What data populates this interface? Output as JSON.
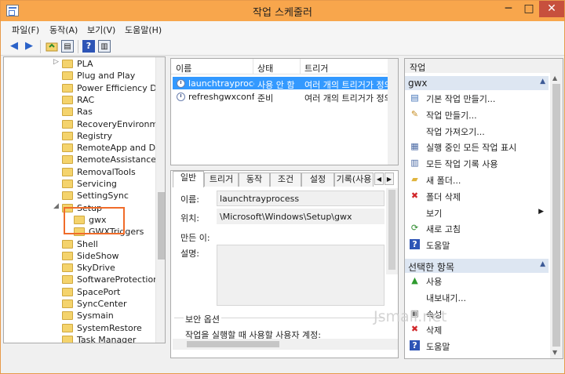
{
  "window": {
    "title": "작업 스케줄러",
    "minimize": "─",
    "maximize": "□",
    "close": "✕"
  },
  "menu": [
    "파일(F)",
    "동작(A)",
    "보기(V)",
    "도움말(H)"
  ],
  "toolbar": {
    "icons": [
      "back-arrow-icon",
      "forward-arrow-icon",
      "folder-up-icon",
      "show-hide-tree-icon",
      "help-icon",
      "show-hide-action-pane-icon"
    ]
  },
  "tree": {
    "items": [
      {
        "label": "PLA",
        "expander": "▷"
      },
      {
        "label": "Plug and Play"
      },
      {
        "label": "Power Efficiency Diag"
      },
      {
        "label": "RAC"
      },
      {
        "label": "Ras"
      },
      {
        "label": "RecoveryEnvironment"
      },
      {
        "label": "Registry"
      },
      {
        "label": "RemoteApp and Desk"
      },
      {
        "label": "RemoteAssistance"
      },
      {
        "label": "RemovalTools"
      },
      {
        "label": "Servicing"
      },
      {
        "label": "SettingSync"
      },
      {
        "label": "Setup",
        "expander": "◢"
      },
      {
        "label": "gwx",
        "child": true
      },
      {
        "label": "GWXTriggers",
        "child": true
      },
      {
        "label": "Shell"
      },
      {
        "label": "SideShow"
      },
      {
        "label": "SkyDrive"
      },
      {
        "label": "SoftwareProtectionPla"
      },
      {
        "label": "SpacePort"
      },
      {
        "label": "SyncCenter"
      },
      {
        "label": "Sysmain"
      },
      {
        "label": "SystemRestore"
      },
      {
        "label": "Task Manager"
      }
    ]
  },
  "task_list": {
    "columns": [
      "이름",
      "상태",
      "트리거"
    ],
    "rows": [
      {
        "name": "launchtrayprocess",
        "status": "사용 안 함",
        "trigger": "여러 개의 트리거가 정의되",
        "selected": true
      },
      {
        "name": "refreshgwxconfig",
        "status": "준비",
        "trigger": "여러 개의 트리거가 정의되",
        "selected": false
      }
    ]
  },
  "detail": {
    "tabs": [
      "일반",
      "트리거",
      "동작",
      "조건",
      "설정",
      "기록(사용"
    ],
    "name_label": "이름:",
    "name_value": "launchtrayprocess",
    "location_label": "위치:",
    "location_value": "\\Microsoft\\Windows\\Setup\\gwx",
    "author_label": "만든 이:",
    "description_label": "설명:",
    "security_options": "보안 옵션",
    "run_as_text": "작업을 실행할 때 사용할 사용자 계정:"
  },
  "actions": {
    "header": "작업",
    "section1": "gwx",
    "section1_items": [
      {
        "label": "기본 작업 만들기...",
        "icon": "create-basic-task-icon"
      },
      {
        "label": "작업 만들기...",
        "icon": "create-task-icon"
      },
      {
        "label": "작업 가져오기...",
        "icon": "import-task-icon"
      },
      {
        "label": "실행 중인 모든 작업 표시",
        "icon": "running-tasks-icon"
      },
      {
        "label": "모든 작업 기록 사용",
        "icon": "task-history-icon"
      },
      {
        "label": "새 폴더...",
        "icon": "new-folder-icon"
      },
      {
        "label": "폴더 삭제",
        "icon": "delete-icon"
      },
      {
        "label": "보기",
        "icon": "",
        "submenu": "▶"
      },
      {
        "label": "새로 고침",
        "icon": "refresh-icon"
      },
      {
        "label": "도움말",
        "icon": "help-icon"
      }
    ],
    "section2": "선택한 항목",
    "section2_items": [
      {
        "label": "사용",
        "icon": "enable-arrow-icon"
      },
      {
        "label": "내보내기...",
        "icon": ""
      },
      {
        "label": "속성",
        "icon": "properties-icon"
      },
      {
        "label": "삭제",
        "icon": "delete-icon"
      },
      {
        "label": "도움말",
        "icon": "help-icon"
      }
    ]
  },
  "watermark": "Jsmall.net",
  "colors": {
    "titlebar": "#f8a64c",
    "close_button": "#c7503d",
    "selection": "#3399ff",
    "highlight_frame": "#f06c2a"
  }
}
